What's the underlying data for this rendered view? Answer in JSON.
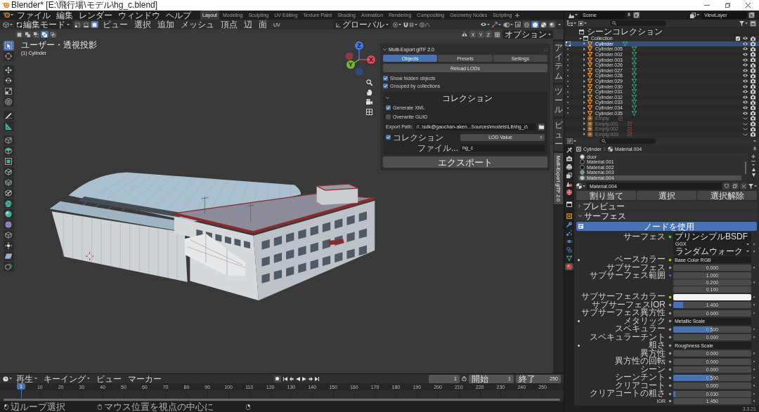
{
  "window": {
    "title": "Blender* [E:\\飛行場\\モデル\\hg_c.blend]"
  },
  "menu_bar": {
    "menus": [
      "ファイル",
      "編集",
      "レンダー",
      "ウィンドウ",
      "ヘルプ"
    ],
    "workspaces": [
      {
        "label": "Layout",
        "selected": true
      },
      {
        "label": "Modeling",
        "selected": false
      },
      {
        "label": "Sculpting",
        "selected": false
      },
      {
        "label": "UV Editing",
        "selected": false
      },
      {
        "label": "Texture Paint",
        "selected": false
      },
      {
        "label": "Shading",
        "selected": false
      },
      {
        "label": "Animation",
        "selected": false
      },
      {
        "label": "Rendering",
        "selected": false
      },
      {
        "label": "Compositing",
        "selected": false
      },
      {
        "label": "Geometry Nodes",
        "selected": false
      },
      {
        "label": "Scripting",
        "selected": false
      }
    ],
    "scene": "Scene",
    "view_layer": "ViewLayer"
  },
  "viewport_header": {
    "mode": "編集モード",
    "select_modes": [
      {
        "kind": "vertex",
        "selected": false
      },
      {
        "kind": "edge",
        "selected": false
      },
      {
        "kind": "face",
        "selected": true
      }
    ],
    "menus": [
      "ビュー",
      "選択",
      "追加",
      "メッシュ",
      "頂点",
      "辺",
      "面",
      "UV"
    ],
    "orientation": "グローバル",
    "shading": [
      {
        "kind": "wireframe",
        "selected": false
      },
      {
        "kind": "solid",
        "selected": true
      },
      {
        "kind": "material",
        "selected": false
      },
      {
        "kind": "rendered",
        "selected": false
      }
    ]
  },
  "tool_settings": {
    "selection_modes": [
      {
        "kind": "set",
        "selected": false
      },
      {
        "kind": "extend",
        "selected": false
      },
      {
        "kind": "subtract",
        "selected": false
      },
      {
        "kind": "difference",
        "selected": true
      },
      {
        "kind": "intersect",
        "selected": false
      }
    ],
    "mirror_axes": [
      "X",
      "Y",
      "Z"
    ],
    "options": "オプション"
  },
  "viewport": {
    "view_name": "ユーザー・透視投影",
    "object_label": "(1) Cylinder",
    "gizmo_axes": [
      "Z",
      "X",
      "Y"
    ],
    "toolbar": [
      {
        "kind": "select",
        "selected": true
      },
      {
        "kind": "cursor",
        "selected": false
      },
      {
        "kind": "move",
        "selected": false
      },
      {
        "kind": "rotate",
        "selected": false
      },
      {
        "kind": "scale",
        "selected": false
      },
      {
        "kind": "transform",
        "selected": false
      },
      {
        "kind": "annotate",
        "selected": false
      },
      {
        "kind": "measure",
        "selected": false
      },
      {
        "kind": "add_cube",
        "selected": false
      },
      {
        "kind": "extrude",
        "selected": false
      },
      {
        "kind": "inset",
        "selected": false
      },
      {
        "kind": "bevel",
        "selected": false
      },
      {
        "kind": "loop_cut",
        "selected": false
      },
      {
        "kind": "knife",
        "selected": false
      },
      {
        "kind": "poly_build",
        "selected": false
      },
      {
        "kind": "spin",
        "selected": false
      },
      {
        "kind": "smooth",
        "selected": false
      },
      {
        "kind": "edge_slide",
        "selected": false
      },
      {
        "kind": "shrink",
        "selected": false
      },
      {
        "kind": "shear",
        "selected": false
      },
      {
        "kind": "rip",
        "selected": false
      }
    ]
  },
  "sidebar": {
    "tabs": [
      {
        "label": "アイテム",
        "selected": false
      },
      {
        "label": "ツール",
        "selected": false
      },
      {
        "label": "ビュー",
        "selected": false
      },
      {
        "label": "Multi-Export glTF 2.0",
        "selected": true
      }
    ],
    "panel": {
      "title": "Multi-Export glTF 2.0",
      "expanded": true,
      "tabs": [
        {
          "label": "Objects",
          "selected": true
        },
        {
          "label": "Presets",
          "selected": false
        },
        {
          "label": "Settings",
          "selected": false
        }
      ],
      "reload_button": "Reload LODs",
      "options": [
        {
          "label": "Show hidden objects",
          "checked": true
        },
        {
          "label": "Grouped by collections",
          "checked": true
        }
      ],
      "collection_box": {
        "title": "コレクション",
        "expanded": true,
        "options": [
          {
            "label": "Generate XML",
            "checked": true
          },
          {
            "label": "Overwrite GUID",
            "checked": false
          }
        ],
        "export_path": {
          "label": "Export Path:",
          "value": "//..\\sdk@gaochan-aken...Sources\\models\\Lib\\hg_c\\"
        },
        "collection": {
          "label": "コレクション",
          "checked": true,
          "dropdown": "LOD Value"
        },
        "file": {
          "label": "ファイル...",
          "value": "hg_c"
        }
      },
      "export_button": "エクスポート"
    }
  },
  "outliner": {
    "tree": [
      {
        "label": "シーンコレクション",
        "kind": "scene_collection",
        "selected": false,
        "children": [
          {
            "label": "Collection",
            "kind": "collection",
            "selected": false,
            "expanded": true,
            "checked": true,
            "children": [
              {
                "label": "Cylinder",
                "kind": "mesh",
                "selected": true,
                "hidden": false,
                "expanded": false
              },
              {
                "label": "Cylinder.005",
                "kind": "mesh",
                "selected": false,
                "hidden": false,
                "expanded": false
              },
              {
                "label": "Cylinder.002",
                "kind": "mesh",
                "selected": false,
                "hidden": false,
                "expanded": false
              },
              {
                "label": "Cylinder.003",
                "kind": "mesh",
                "selected": false,
                "hidden": false,
                "expanded": false
              },
              {
                "label": "Cylinder.026",
                "kind": "mesh",
                "selected": false,
                "hidden": false,
                "expanded": false
              },
              {
                "label": "Cylinder.027",
                "kind": "mesh",
                "selected": false,
                "hidden": false,
                "expanded": false
              },
              {
                "label": "Cylinder.028",
                "kind": "mesh",
                "selected": false,
                "hidden": false,
                "expanded": false
              },
              {
                "label": "Cylinder.029",
                "kind": "mesh",
                "selected": false,
                "hidden": false,
                "expanded": false
              },
              {
                "label": "Cylinder.030",
                "kind": "mesh",
                "selected": false,
                "hidden": false,
                "expanded": false
              },
              {
                "label": "Cylinder.031",
                "kind": "mesh",
                "selected": false,
                "hidden": false,
                "expanded": false
              },
              {
                "label": "Cylinder.032",
                "kind": "mesh",
                "selected": false,
                "hidden": false,
                "expanded": false
              },
              {
                "label": "Cylinder.033",
                "kind": "mesh",
                "selected": false,
                "hidden": false,
                "expanded": false
              },
              {
                "label": "Cylinder.034",
                "kind": "mesh",
                "selected": false,
                "hidden": false,
                "expanded": false
              },
              {
                "label": "Cylinder.035",
                "kind": "mesh",
                "selected": false,
                "hidden": false,
                "expanded": false
              },
              {
                "label": "Empty",
                "kind": "empty",
                "selected": false,
                "hidden": true,
                "expanded": false
              },
              {
                "label": "Empty.001",
                "kind": "empty",
                "selected": false,
                "hidden": true,
                "expanded": false
              },
              {
                "label": "Empty.002",
                "kind": "empty",
                "selected": false,
                "hidden": true,
                "expanded": false
              },
              {
                "label": "Empty.003",
                "kind": "empty",
                "selected": false,
                "hidden": true,
                "expanded": false
              }
            ]
          }
        ]
      }
    ]
  },
  "properties": {
    "tabs": [
      {
        "kind": "tool",
        "selected": false
      },
      {
        "kind": "render",
        "selected": false
      },
      {
        "kind": "output",
        "selected": false
      },
      {
        "kind": "view_layer",
        "selected": false
      },
      {
        "kind": "scene",
        "selected": false
      },
      {
        "kind": "world",
        "selected": false
      },
      {
        "kind": "collection",
        "selected": false
      },
      {
        "kind": "object",
        "selected": false
      },
      {
        "kind": "modifiers",
        "selected": false
      },
      {
        "kind": "particles",
        "selected": false
      },
      {
        "kind": "physics",
        "selected": false
      },
      {
        "kind": "constraints",
        "selected": false
      },
      {
        "kind": "data",
        "selected": false
      },
      {
        "kind": "material",
        "selected": true
      }
    ],
    "breadcrumb": [
      "Cylinder",
      "Material.004"
    ],
    "material_slots": [
      {
        "name": "door",
        "color": "#e4e4e4",
        "selected": false
      },
      {
        "name": "Material.001",
        "color": "#1e1e1e",
        "selected": false
      },
      {
        "name": "Material.002",
        "color": "#111111",
        "selected": false
      },
      {
        "name": "Material.003",
        "color": "#6f9a8c",
        "selected": false
      },
      {
        "name": "Material.004",
        "color": "#c4c4c4",
        "selected": true
      }
    ],
    "material": "Material.004",
    "slot_buttons": [
      "割り当て",
      "選択",
      "選択解除"
    ],
    "panels": [
      {
        "title": "プレビュー",
        "expanded": false
      },
      {
        "title": "サーフェス",
        "expanded": true
      }
    ],
    "use_nodes_button": "ノードを使用",
    "inputs": [
      {
        "kind": "link",
        "label": "サーフェス",
        "color": "#63c763",
        "value": "プリンシプルBSDF",
        "expandable": false
      },
      {
        "kind": "enum",
        "value": "GGX"
      },
      {
        "kind": "enum",
        "value": "ランダムウォーク"
      },
      {
        "kind": "link",
        "label": "ベースカラー",
        "color": "#c7c729",
        "value": "Base Color RGB",
        "expandable": true
      },
      {
        "kind": "value",
        "label": "サブサーフェス",
        "color": "#a1a1a1",
        "value": "0.000"
      },
      {
        "kind": "vector",
        "label": "サブサーフェス範囲",
        "color": "#6363c7",
        "values": [
          "1.000",
          "0.200",
          "0.100"
        ]
      },
      {
        "kind": "color",
        "label": "サブサーフェスカラー",
        "color": "#c7c729",
        "swatch": {
          "color": "#f2f2f2"
        }
      },
      {
        "kind": "value",
        "label": "サブサーフェスIOR",
        "color": "#a1a1a1",
        "value": "1.400",
        "level": 0.13
      },
      {
        "kind": "value",
        "label": "サブサーフェス異方性",
        "color": "#a1a1a1",
        "value": "0.000"
      },
      {
        "kind": "link",
        "label": "メタリック",
        "color": "#a1a1a1",
        "value": "Metallic Scale",
        "expandable": true
      },
      {
        "kind": "value",
        "label": "スペキュラー",
        "color": "#a1a1a1",
        "value": "0.500",
        "level": 0.5
      },
      {
        "kind": "value",
        "label": "スペキュラーチント",
        "color": "#a1a1a1",
        "value": "0.000"
      },
      {
        "kind": "link",
        "label": "粗さ",
        "color": "#a1a1a1",
        "value": "Roughness Scale",
        "expandable": true
      },
      {
        "kind": "value",
        "label": "異方性",
        "color": "#a1a1a1",
        "value": "0.000"
      },
      {
        "kind": "value",
        "label": "異方性の回転",
        "color": "#a1a1a1",
        "value": "0.000"
      },
      {
        "kind": "value",
        "label": "シーン",
        "color": "#a1a1a1",
        "value": "0.000"
      },
      {
        "kind": "value",
        "label": "シーンチント",
        "color": "#a1a1a1",
        "value": "0.500",
        "level": 0.5
      },
      {
        "kind": "value",
        "label": "クリアコート",
        "color": "#a1a1a1",
        "value": "0.000"
      },
      {
        "kind": "value",
        "label": "クリアコートの粗さ",
        "color": "#a1a1a1",
        "value": "0.030",
        "level": 0.03
      },
      {
        "kind": "value",
        "label": "IOR",
        "color": "#a1a1a1",
        "value": "1.450"
      }
    ]
  },
  "timeline": {
    "menus": [
      {
        "label": "再生",
        "dropdown": true
      },
      {
        "label": "キーイング",
        "dropdown": true
      },
      {
        "label": "ビュー",
        "dropdown": false
      },
      {
        "label": "マーカー",
        "dropdown": false
      }
    ],
    "current_frame": "1",
    "start": {
      "label": "開始",
      "value": "1"
    },
    "end": {
      "label": "終了",
      "value": "250"
    },
    "playhead": "1",
    "ruler": [
      "10",
      "20",
      "30",
      "40",
      "50",
      "60",
      "70",
      "80",
      "90",
      "100",
      "110",
      "120",
      "130",
      "140",
      "150",
      "160",
      "170",
      "180",
      "190",
      "200",
      "210",
      "220",
      "230",
      "240",
      "250"
    ]
  },
  "status_bar": {
    "hints": [
      {
        "kind": "left_click",
        "label": "辺ループ選択"
      },
      {
        "kind": "middle_click",
        "label": "マウス位置を視点の中心に"
      },
      {
        "kind": "right_click"
      }
    ],
    "version": "3.3.21"
  }
}
